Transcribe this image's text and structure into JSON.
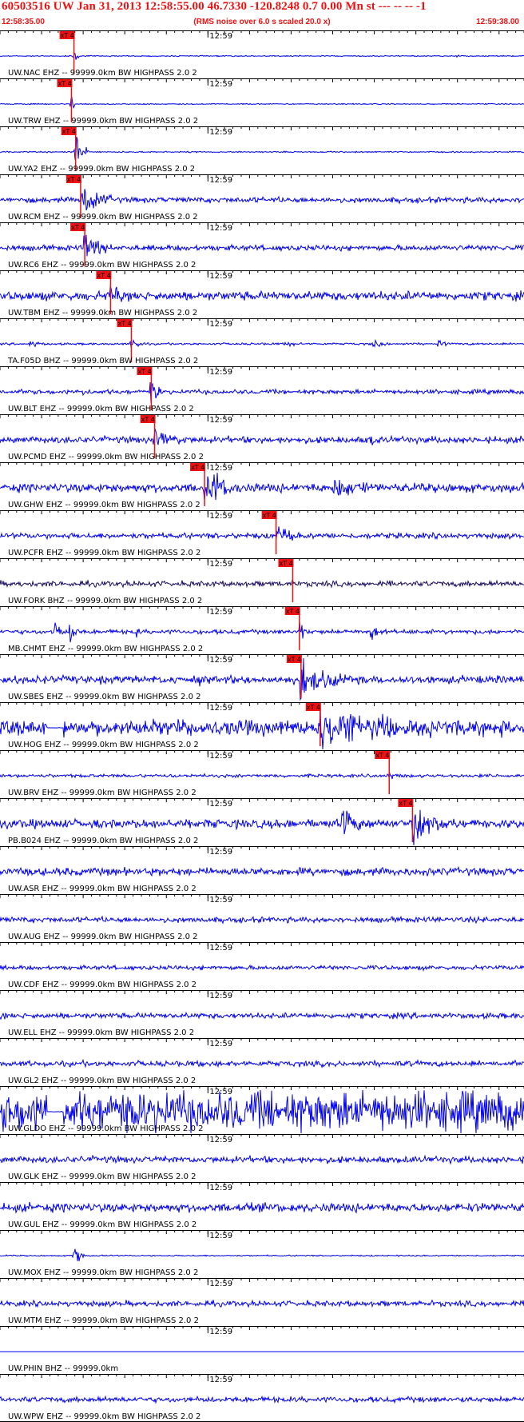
{
  "header": {
    "title": "60503516 UW Jan 31, 2013 12:58:55.00   46.7330 -120.8248  0.7 0.00 Mn st --- -- --  -1",
    "start_time": "12:58:35.00",
    "scale_note": "(RMS noise over 6.0 s scaled 20.0 x)",
    "end_time": "12:59:38.00"
  },
  "colors": {
    "header_text": "#ee1111",
    "trace": "#0000ee",
    "trace_dark": "#1a0a60",
    "pick_flag": "#ee1111",
    "grid": "#000000"
  },
  "minute_label": "12:59",
  "pick_label": "xT 4",
  "traces": [
    {
      "label": "UW.NAC EHZ -- 99999.0km BW  HIGHPASS  2.0  2",
      "pick_s": 8.7,
      "style": "event",
      "noise": 0.5,
      "event_amp": 18,
      "event_dur": 0.8,
      "extra": [
        {
          "t": 54.8,
          "amp": 5,
          "dur": 0.4
        }
      ]
    },
    {
      "label": "UW.TRW EHZ -- 99999.0km BW  HIGHPASS  2.0  2",
      "pick_s": 8.4,
      "style": "event",
      "noise": 0.5,
      "event_amp": 18,
      "event_dur": 0.7,
      "extra": []
    },
    {
      "label": "UW.YA2 EHZ -- 99999.0km BW  HIGHPASS  2.0  2",
      "pick_s": 8.9,
      "style": "event",
      "noise": 0.6,
      "event_amp": 22,
      "event_dur": 1.8,
      "extra": []
    },
    {
      "label": "UW.RCM EHZ -- 99999.0km BW  HIGHPASS  2.0  2",
      "pick_s": 9.5,
      "style": "event",
      "noise": 2.5,
      "event_amp": 20,
      "event_dur": 4.0,
      "extra": []
    },
    {
      "label": "UW.RC6 EHZ -- 99999.0km BW  HIGHPASS  2.0  2",
      "pick_s": 10.0,
      "style": "event",
      "noise": 2.5,
      "event_amp": 18,
      "event_dur": 3.5,
      "extra": []
    },
    {
      "label": "UW.TBM EHZ -- 99999.0km BW  HIGHPASS  2.0  2",
      "pick_s": 13.1,
      "style": "event",
      "noise": 4.0,
      "event_amp": 14,
      "event_dur": 3.0,
      "extra": []
    },
    {
      "label": "TA.F05D BHZ -- 99999.0km BW  HIGHPASS  2.0  2",
      "pick_s": 15.6,
      "style": "bursty",
      "noise": 1.2,
      "event_amp": 8,
      "event_dur": 2.0,
      "extra": [
        {
          "t": 3.5,
          "amp": 4,
          "dur": 2.5
        },
        {
          "t": 34.2,
          "amp": 4,
          "dur": 2.5
        },
        {
          "t": 44.5,
          "amp": 5,
          "dur": 2.5
        },
        {
          "t": 52.5,
          "amp": 5,
          "dur": 1.5
        }
      ]
    },
    {
      "label": "UW.BLT EHZ -- 99999.0km BW  HIGHPASS  2.0  2",
      "pick_s": 18.0,
      "style": "event",
      "noise": 2.0,
      "event_amp": 22,
      "event_dur": 1.5,
      "extra": [
        {
          "t": 9.8,
          "amp": 14,
          "dur": 0.4
        },
        {
          "t": 34.0,
          "amp": 8,
          "dur": 0.4
        }
      ]
    },
    {
      "label": "UW.PCMD EHZ -- 99999.0km BW  HIGHPASS  2.0  2",
      "pick_s": 18.4,
      "style": "event",
      "noise": 3.0,
      "event_amp": 14,
      "event_dur": 4.0,
      "extra": [
        {
          "t": 44.3,
          "amp": 10,
          "dur": 1.5
        }
      ]
    },
    {
      "label": "UW.GHW EHZ -- 99999.0km BW  HIGHPASS  2.0  2",
      "pick_s": 24.4,
      "style": "event",
      "noise": 4.0,
      "event_amp": 22,
      "event_dur": 5.0,
      "extra": [
        {
          "t": 40.0,
          "amp": 16,
          "dur": 5.0
        }
      ]
    },
    {
      "label": "UW.PCFR EHZ -- 99999.0km BW  HIGHPASS  2.0  2",
      "pick_s": 33.0,
      "style": "event",
      "noise": 2.5,
      "event_amp": 24,
      "event_dur": 2.5,
      "extra": []
    },
    {
      "label": "UW.FORK BHZ -- 99999.0km BW  HIGHPASS  2.0  2",
      "pick_s": 35.0,
      "style": "dark",
      "noise": 2.5,
      "event_amp": 4,
      "event_dur": 1.0,
      "extra": []
    },
    {
      "label": "MB.CHMT EHZ -- 99999.0km BW  HIGHPASS  2.0  2",
      "pick_s": 35.8,
      "style": "event",
      "noise": 2.0,
      "event_amp": 20,
      "event_dur": 1.5,
      "extra": [
        {
          "t": 6.5,
          "amp": 18,
          "dur": 1.0
        },
        {
          "t": 8.3,
          "amp": 18,
          "dur": 1.2
        },
        {
          "t": 16.3,
          "amp": 14,
          "dur": 0.5
        },
        {
          "t": 44.5,
          "amp": 14,
          "dur": 1.5
        }
      ]
    },
    {
      "label": "UW.SBES EHZ -- 99999.0km BW  HIGHPASS  2.0  2",
      "pick_s": 36.0,
      "style": "event",
      "noise": 3.5,
      "event_amp": 22,
      "event_dur": 7.0,
      "extra": [
        {
          "t": 23.7,
          "amp": 14,
          "dur": 0.5
        }
      ]
    },
    {
      "label": "UW.HOG EHZ -- 99999.0km BW  HIGHPASS  2.0  2",
      "pick_s": 38.3,
      "style": "noisygap",
      "noise": 7.0,
      "event_amp": 24,
      "event_dur": 14.0,
      "extra": []
    },
    {
      "label": "UW.BRV EHZ -- 99999.0km BW  HIGHPASS  2.0  2",
      "pick_s": 46.6,
      "style": "event",
      "noise": 1.5,
      "event_amp": 4,
      "event_dur": 2.0,
      "extra": []
    },
    {
      "label": "PB.B024 EHZ -- 99999.0km BW  HIGHPASS  2.0  2",
      "pick_s": 49.4,
      "style": "event",
      "noise": 4.0,
      "event_amp": 22,
      "event_dur": 6.0,
      "extra": [
        {
          "t": 41.0,
          "amp": 14,
          "dur": 6.0
        }
      ]
    },
    {
      "label": "UW.ASR EHZ -- 99999.0km BW  HIGHPASS  2.0  2",
      "pick_s": null,
      "style": "noise",
      "noise": 3.5,
      "event_amp": 0,
      "event_dur": 0,
      "extra": []
    },
    {
      "label": "UW.AUG EHZ -- 99999.0km BW  HIGHPASS  2.0  2",
      "pick_s": null,
      "style": "noise",
      "noise": 2.5,
      "event_amp": 0,
      "event_dur": 0,
      "extra": []
    },
    {
      "label": "UW.CDF EHZ -- 99999.0km BW  HIGHPASS  2.0  2",
      "pick_s": null,
      "style": "noise",
      "noise": 2.0,
      "event_amp": 0,
      "event_dur": 0,
      "extra": []
    },
    {
      "label": "UW.ELL EHZ -- 99999.0km BW  HIGHPASS  2.0  2",
      "pick_s": null,
      "style": "noise",
      "noise": 2.5,
      "event_amp": 0,
      "event_dur": 0,
      "extra": []
    },
    {
      "label": "UW.GL2 EHZ -- 99999.0km BW  HIGHPASS  2.0  2",
      "pick_s": null,
      "style": "noise",
      "noise": 2.5,
      "event_amp": 0,
      "event_dur": 0,
      "extra": []
    },
    {
      "label": "UW.GLDO EHZ -- 99999.0km BW  HIGHPASS  2.0  2",
      "pick_s": null,
      "style": "noisygap",
      "noise": 18.0,
      "event_amp": 0,
      "event_dur": 0,
      "extra": []
    },
    {
      "label": "UW.GLK EHZ -- 99999.0km BW  HIGHPASS  2.0  2",
      "pick_s": null,
      "style": "noise",
      "noise": 3.0,
      "event_amp": 0,
      "event_dur": 0,
      "extra": []
    },
    {
      "label": "UW.GUL EHZ -- 99999.0km BW  HIGHPASS  2.0  2",
      "pick_s": null,
      "style": "noise",
      "noise": 4.0,
      "event_amp": 0,
      "event_dur": 0,
      "extra": []
    },
    {
      "label": "UW.MOX EHZ -- 99999.0km BW  HIGHPASS  2.0  2",
      "pick_s": null,
      "style": "quiet",
      "noise": 0.6,
      "event_amp": 0,
      "event_dur": 0,
      "extra": [
        {
          "t": 8.7,
          "amp": 20,
          "dur": 1.4
        }
      ]
    },
    {
      "label": "UW.MTM EHZ -- 99999.0km BW  HIGHPASS  2.0  2",
      "pick_s": null,
      "style": "noise",
      "noise": 2.5,
      "event_amp": 0,
      "event_dur": 0,
      "extra": []
    },
    {
      "label": "UW.PHIN BHZ -- 99999.0km",
      "pick_s": null,
      "style": "flat",
      "noise": 0,
      "event_amp": 0,
      "event_dur": 0,
      "extra": []
    },
    {
      "label": "UW.WPW EHZ -- 99999.0km BW  HIGHPASS  2.0  2",
      "pick_s": null,
      "style": "noise",
      "noise": 2.5,
      "event_amp": 0,
      "event_dur": 0,
      "extra": []
    }
  ]
}
